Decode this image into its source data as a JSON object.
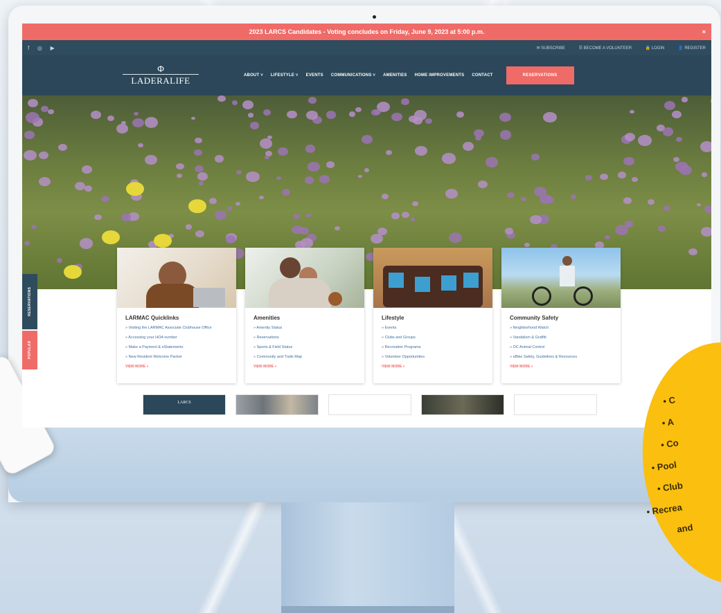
{
  "alert": {
    "text": "2023 LARCS Candidates - Voting concludes on Friday, June 9, 2023 at 5:00 p.m.",
    "close": "×"
  },
  "utility": {
    "social": [
      "f",
      "◎",
      "▶"
    ],
    "links": [
      "✉ SUBSCRIBE",
      "☰ BECOME A VOLUNTEER",
      "🔒 LOGIN",
      "👤 REGISTER"
    ]
  },
  "logo": {
    "mark": "Φ",
    "text": "LADERALIFE"
  },
  "nav": {
    "items": [
      "ABOUT ˅",
      "LIFESTYLE ˅",
      "EVENTS",
      "COMMUNICATIONS ˅",
      "AMENITIES",
      "HOME IMPROVEMENTS",
      "CONTACT"
    ],
    "reservations": "RESERVATIONS"
  },
  "side_tabs": {
    "reservations": "RESERVATIONS",
    "popular": "POPULAR"
  },
  "cards": [
    {
      "title": "LARMAC Quicklinks",
      "links": [
        "» Visiting the LARMAC Associate Clubhouse Office",
        "» Accessing your HOA number",
        "» Make a Payment & eStatements",
        "» New Resident Welcome Packet"
      ],
      "more": "VIEW MORE »"
    },
    {
      "title": "Amenities",
      "links": [
        "» Amenity Status",
        "» Reservations",
        "» Sports & Field Status",
        "» Community and Trails Map"
      ],
      "more": "VIEW MORE »"
    },
    {
      "title": "Lifestyle",
      "links": [
        "» Events",
        "» Clubs and Groups",
        "» Recreation Programs",
        "» Volunteer Opportunities"
      ],
      "more": "VIEW MORE »"
    },
    {
      "title": "Community Safety",
      "links": [
        "» Neighborhood Watch",
        "» Vandalism & Graffiti",
        "» OC Animal Control",
        "» eBike Safety, Guidelines & Resources"
      ],
      "more": "VIEW MORE »"
    }
  ],
  "thumbs": {
    "first_label": "LARCS"
  },
  "badge": {
    "lines_top": [
      "• C",
      "• A",
      "• Co"
    ],
    "lines_bottom": [
      "• Pool",
      "• Club",
      "• Recrea",
      "and"
    ]
  },
  "colors": {
    "accent": "#ef6b68",
    "navy": "#2b4759",
    "badge": "#fbbf10"
  }
}
